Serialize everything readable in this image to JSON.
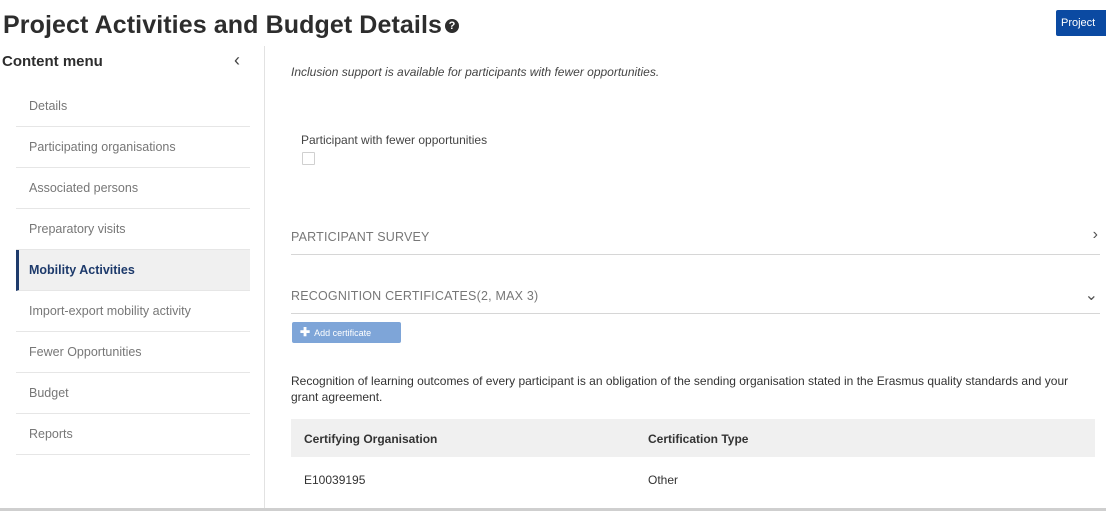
{
  "header": {
    "title": "Project Activities and Budget Details",
    "help_icon": "?",
    "project_button": "Project"
  },
  "sidebar": {
    "title": "Content menu",
    "collapse_icon": "‹",
    "items": [
      {
        "label": "Details"
      },
      {
        "label": "Participating organisations"
      },
      {
        "label": "Associated persons"
      },
      {
        "label": "Preparatory visits"
      },
      {
        "label": "Mobility Activities",
        "active": true
      },
      {
        "label": "Import-export mobility activity"
      },
      {
        "label": "Fewer Opportunities"
      },
      {
        "label": "Budget"
      },
      {
        "label": "Reports"
      }
    ]
  },
  "main": {
    "inclusion_note": "Inclusion support is available for participants with fewer opportunities.",
    "fewer_opportunities_label": "Participant with fewer opportunities",
    "fewer_opportunities_checked": false,
    "participant_survey": {
      "title": "PARTICIPANT SURVEY",
      "icon": "›"
    },
    "recognition_certificates": {
      "title": "RECOGNITION CERTIFICATES(2, MAX 3)",
      "icon": "⌄"
    },
    "add_certificate_label": "Add certificate",
    "recognition_text": "Recognition of learning outcomes of every participant is an obligation of the sending organisation stated in the Erasmus quality standards and your grant agreement.",
    "table": {
      "headers": [
        "Certifying Organisation",
        "Certification Type"
      ],
      "rows": [
        [
          "E10039195",
          "Other"
        ]
      ]
    }
  },
  "colors": {
    "accent": "#0b4aa2",
    "active_menu": "#1d3a6b",
    "add_button": "#7ea5d8"
  }
}
